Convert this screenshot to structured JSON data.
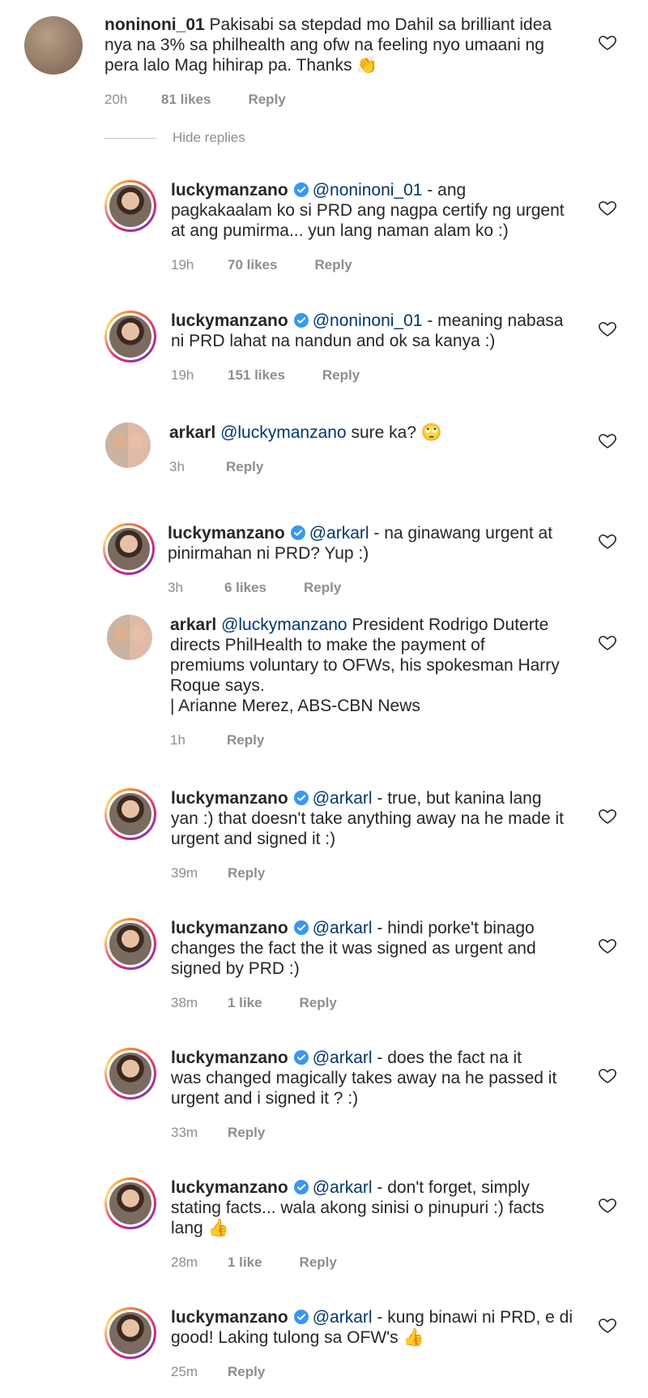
{
  "comments": [
    {
      "username": "noninoni_01",
      "verified": false,
      "mention": "",
      "lines": [
        "Pakisabi sa stepdad mo Dahil sa brilliant idea",
        "nya na 3% sa philhealth ang ofw na feeling nyo umaani ng",
        "pera lalo Mag hihirap pa. Thanks 👏"
      ],
      "time": "20h",
      "likes": "81 likes",
      "reply": "Reply"
    },
    {
      "username": "luckymanzano",
      "verified": true,
      "mention": "@noninoni_01",
      "lines": [
        " - ang",
        "pagkakaalam ko si PRD ang nagpa certify ng urgent",
        "at ang pumirma... yun lang naman alam ko :)"
      ],
      "time": "19h",
      "likes": "70 likes",
      "reply": "Reply"
    },
    {
      "username": "luckymanzano",
      "verified": true,
      "mention": "@noninoni_01",
      "lines": [
        " - meaning nabasa",
        "ni PRD lahat na nandun and ok sa kanya :)"
      ],
      "time": "19h",
      "likes": "151 likes",
      "reply": "Reply"
    },
    {
      "username": "arkarl",
      "verified": false,
      "mention": "@luckymanzano",
      "lines": [
        " sure ka? 🙄"
      ],
      "time": "3h",
      "likes": "",
      "reply": "Reply"
    },
    {
      "username": "luckymanzano",
      "verified": true,
      "mention": "@arkarl",
      "lines": [
        " - na ginawang urgent at",
        "pinirmahan ni PRD? Yup :)"
      ],
      "time": "3h",
      "likes": "6 likes",
      "reply": "Reply"
    },
    {
      "username": "arkarl",
      "verified": false,
      "mention": "@luckymanzano",
      "lines": [
        " President Rodrigo Duterte",
        "directs PhilHealth to make the payment of",
        "premiums voluntary to OFWs, his spokesman Harry",
        "Roque says.",
        "| Arianne Merez, ABS-CBN News"
      ],
      "time": "1h",
      "likes": "",
      "reply": "Reply"
    },
    {
      "username": "luckymanzano",
      "verified": true,
      "mention": "@arkarl",
      "lines": [
        " - true, but kanina lang",
        "yan :) that doesn't take anything away na he made it",
        "urgent and signed it :)"
      ],
      "time": "39m",
      "likes": "",
      "reply": "Reply"
    },
    {
      "username": "luckymanzano",
      "verified": true,
      "mention": "@arkarl",
      "lines": [
        " - hindi porke't binago",
        "changes the fact the it was signed as urgent and",
        "signed by PRD :)"
      ],
      "time": "38m",
      "likes": "1 like",
      "reply": "Reply"
    },
    {
      "username": "luckymanzano",
      "verified": true,
      "mention": "@arkarl",
      "lines": [
        " - does the fact na it",
        "was changed magically takes away na he passed it",
        "urgent and i signed it ? :)"
      ],
      "time": "33m",
      "likes": "",
      "reply": "Reply"
    },
    {
      "username": "luckymanzano",
      "verified": true,
      "mention": "@arkarl",
      "lines": [
        " - don't forget, simply",
        "stating facts... wala akong sinisi o pinupuri :) facts",
        "lang 👍"
      ],
      "time": "28m",
      "likes": "1 like",
      "reply": "Reply"
    },
    {
      "username": "luckymanzano",
      "verified": true,
      "mention": "@arkarl",
      "lines": [
        " - kung binawi ni PRD, e di",
        "good! Laking tulong sa OFW's 👍"
      ],
      "time": "25m",
      "likes": "",
      "reply": "Reply"
    }
  ],
  "hide_replies": "Hide replies",
  "icons": {
    "like": "heart-outline-icon",
    "verified": "verified-badge-icon"
  },
  "colors": {
    "verified": "#3897f0",
    "mention": "#00376b",
    "meta": "#8e8e8e"
  }
}
